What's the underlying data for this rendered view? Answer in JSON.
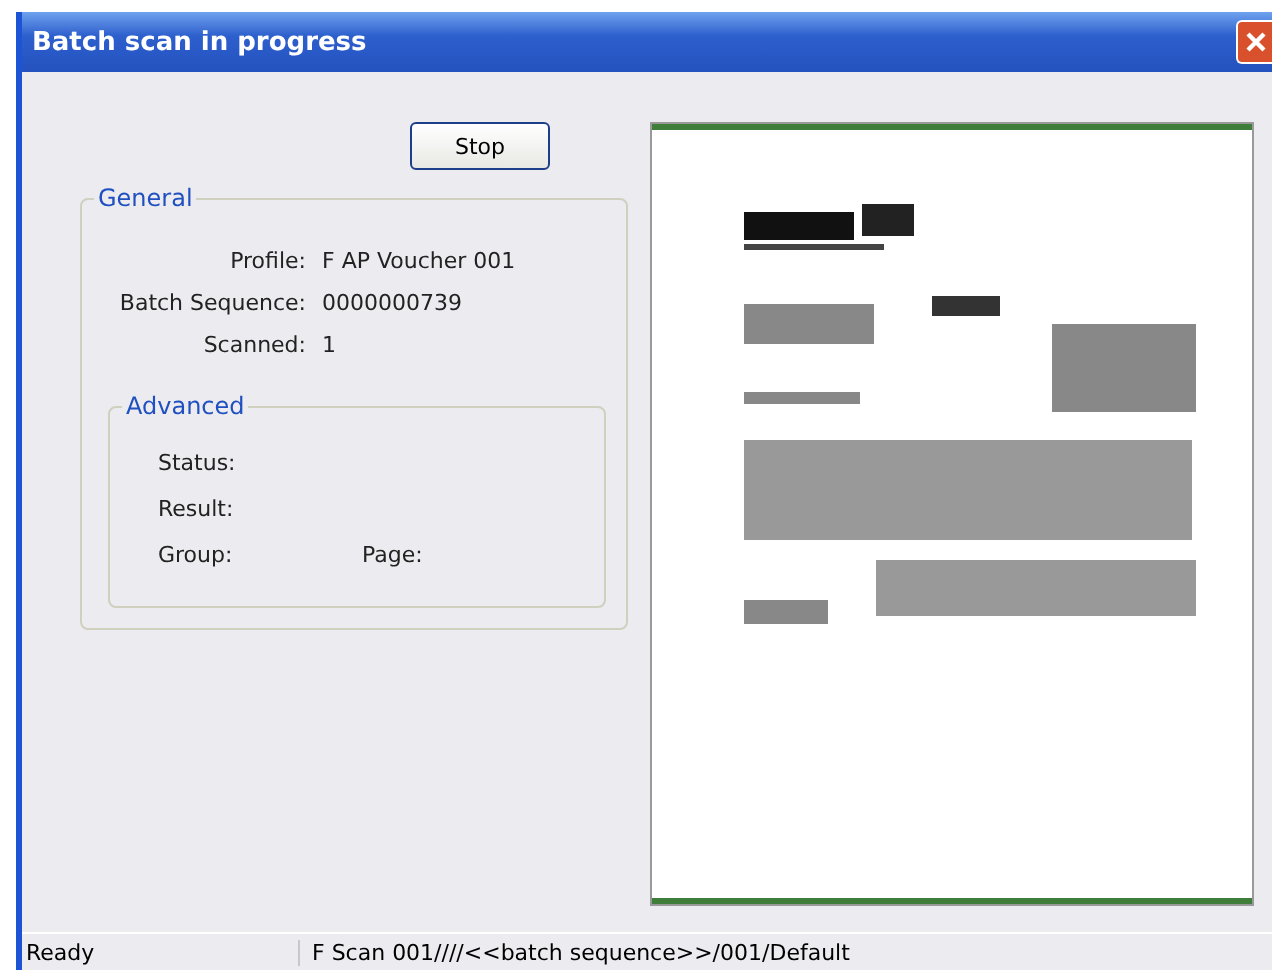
{
  "window": {
    "title": "Batch scan in progress"
  },
  "stop_button": {
    "label": "Stop"
  },
  "general": {
    "title": "General",
    "fields": [
      {
        "label": "Profile:",
        "value": "F AP Voucher 001"
      },
      {
        "label": "Batch Sequence:",
        "value": "0000000739"
      },
      {
        "label": "Scanned:",
        "value": "1"
      }
    ]
  },
  "advanced": {
    "title": "Advanced",
    "rows": [
      [
        {
          "label": "Status:"
        }
      ],
      [
        {
          "label": "Result:"
        }
      ],
      [
        {
          "label": "Group:"
        },
        {
          "label": "Page:"
        }
      ]
    ]
  },
  "preview": {
    "kind": "picture"
  },
  "status_bar": [
    "Ready",
    "F Scan 001////<<batch sequence>>/001/Default"
  ]
}
